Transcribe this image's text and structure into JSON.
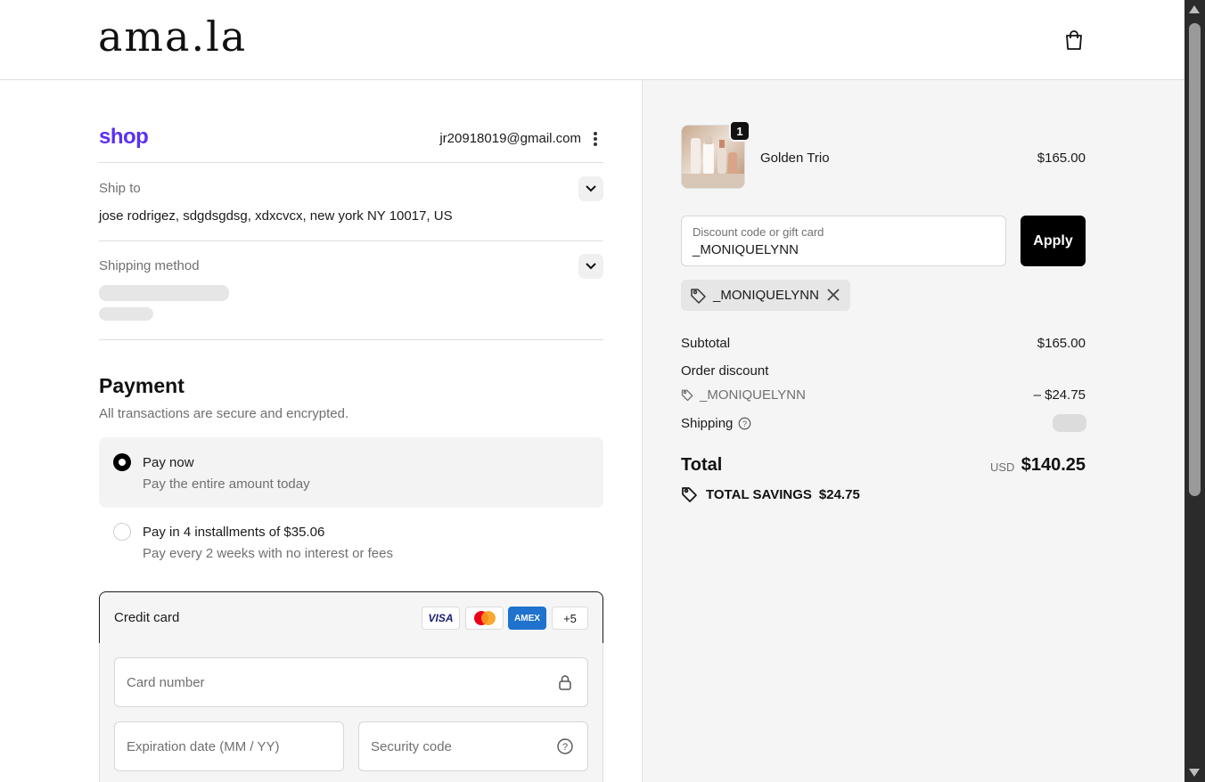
{
  "header": {
    "logo": "ama.la"
  },
  "shop": {
    "brand": "shop",
    "email": "jr20918019@gmail.com"
  },
  "ship_to": {
    "label": "Ship to",
    "address": "jose rodrigez, sdgdsgdsg, xdxcvcx, new york NY 10017, US"
  },
  "shipping_method": {
    "label": "Shipping method"
  },
  "payment": {
    "title": "Payment",
    "subtitle": "All transactions are secure and encrypted.",
    "options": [
      {
        "title": "Pay now",
        "subtitle": "Pay the entire amount today",
        "selected": true
      },
      {
        "title": "Pay in 4 installments of $35.06",
        "subtitle": "Pay every 2 weeks with no interest or fees",
        "selected": false
      }
    ],
    "credit_card": {
      "label": "Credit card",
      "brands": [
        "VISA",
        "mastercard",
        "AMEX",
        "+5"
      ],
      "card_number_placeholder": "Card number",
      "expiry_placeholder": "Expiration date (MM / YY)",
      "security_placeholder": "Security code"
    }
  },
  "order": {
    "item": {
      "name": "Golden Trio",
      "price": "$165.00",
      "quantity": "1"
    },
    "discount": {
      "placeholder": "Discount code or gift card",
      "value": "_MONIQUELYNN",
      "apply_label": "Apply",
      "applied_code": "_MONIQUELYNN"
    },
    "summary": {
      "subtotal_label": "Subtotal",
      "subtotal_value": "$165.00",
      "order_discount_label": "Order discount",
      "discount_code": "_MONIQUELYNN",
      "discount_value": "– $24.75",
      "shipping_label": "Shipping",
      "total_label": "Total",
      "currency": "USD",
      "total_value": "$140.25",
      "savings_label": "TOTAL SAVINGS",
      "savings_value": "$24.75"
    }
  },
  "colors": {
    "shop_brand": "#5a31f4",
    "apply_button": "#000000",
    "summary_background": "#f5f5f5",
    "amex_blue": "#1f72cd"
  }
}
